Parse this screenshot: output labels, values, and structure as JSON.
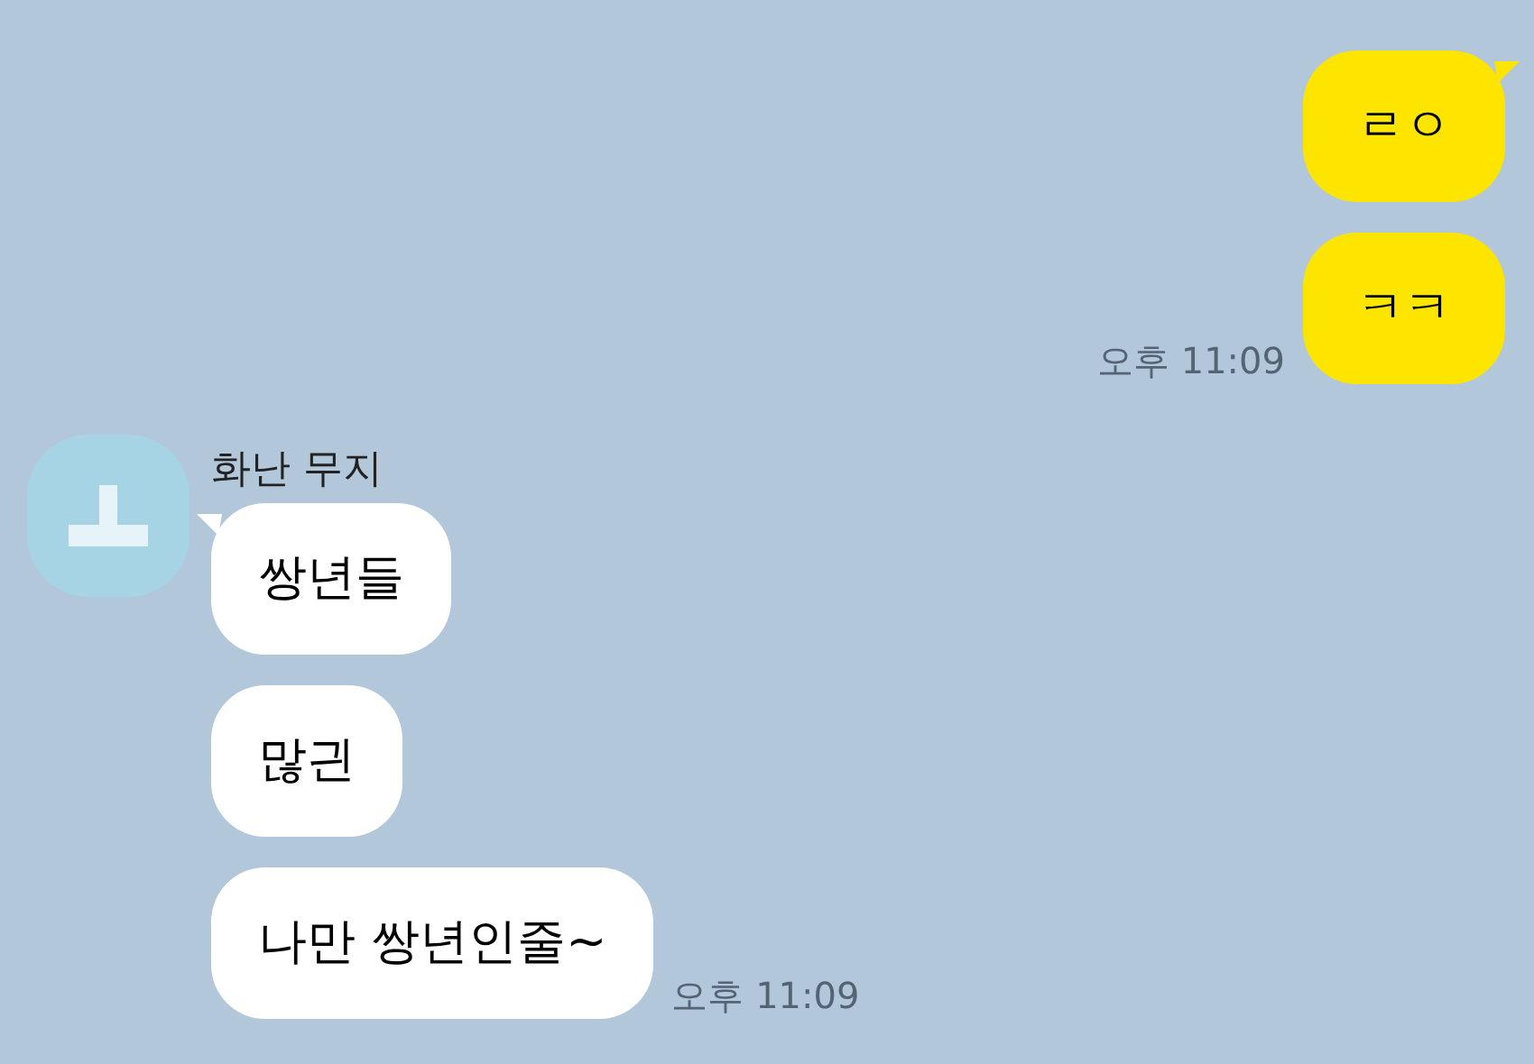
{
  "sent": {
    "messages": [
      {
        "text": "ㄹㅇ",
        "tail": true
      },
      {
        "text": "ㅋㅋ",
        "tail": false
      }
    ],
    "time": "오후 11:09"
  },
  "received": {
    "sender": "화난 무지",
    "messages": [
      {
        "text": "쌍년들",
        "tail": true
      },
      {
        "text": "많긘",
        "tail": false
      },
      {
        "text": "나만 쌍년인줄~",
        "tail": false
      }
    ],
    "time": "오후 11:09"
  }
}
